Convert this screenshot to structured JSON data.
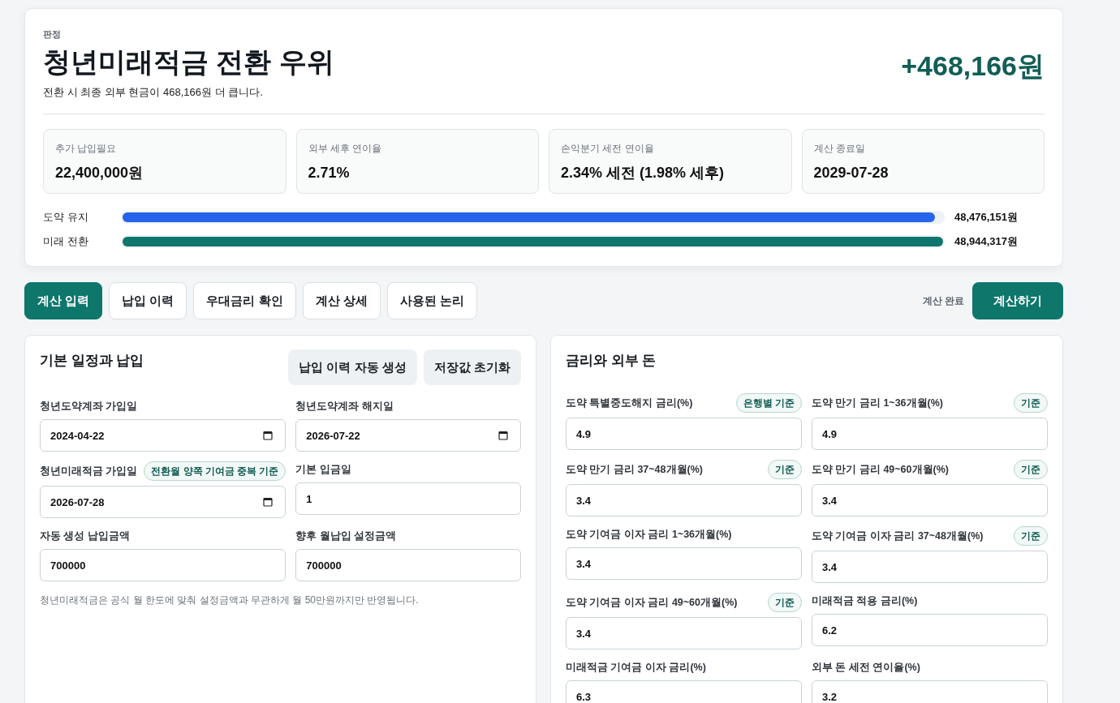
{
  "verdict": {
    "eyebrow": "판정",
    "title": "청년미래적금 전환 우위",
    "summary": "전환 시 최종 외부 현금이 468,166원 더 큽니다.",
    "difference": "+468,166원"
  },
  "stats": [
    {
      "label": "추가 납입필요",
      "value": "22,400,000원"
    },
    {
      "label": "외부 세후 연이율",
      "value": "2.71%"
    },
    {
      "label": "손익분기 세전 연이율",
      "value": "2.34% 세전 (1.98% 세후)"
    },
    {
      "label": "계산 종료일",
      "value": "2029-07-28"
    }
  ],
  "comparison": [
    {
      "label": "도약 유지",
      "level": 0.99,
      "color": "#2563eb",
      "amount": "48,476,151원"
    },
    {
      "label": "미래 전환",
      "level": 1,
      "color": "#0f766e",
      "amount": "48,944,317원"
    }
  ],
  "tabs": [
    {
      "label": "계산 입력",
      "selected": true
    },
    {
      "label": "납입 이력",
      "selected": false
    },
    {
      "label": "우대금리 확인",
      "selected": false
    },
    {
      "label": "계산 상세",
      "selected": false
    },
    {
      "label": "사용된 논리",
      "selected": false
    }
  ],
  "status": "계산 완료",
  "primary_button": "계산하기",
  "schedule_panel": {
    "title": "기본 일정과 납입",
    "buttons": [
      "납입 이력 자동 생성",
      "저장값 초기화"
    ],
    "fields": [
      {
        "label": "청년도약계좌 가입일",
        "kind": "date",
        "value": "2024-04-22"
      },
      {
        "label": "청년도약계좌 해지일",
        "kind": "date",
        "value": "2026-07-22"
      },
      {
        "label": "청년미래적금 가입일",
        "badge": "전환월 양쪽 기여금 중복 기준",
        "kind": "date",
        "value": "2026-07-28"
      },
      {
        "label": "기본 입금일",
        "kind": "number",
        "value": "1"
      },
      {
        "label": "자동 생성 납입금액",
        "kind": "number",
        "value": "700000"
      },
      {
        "label": "향후 월납입 설정금액",
        "kind": "number",
        "value": "700000"
      }
    ],
    "note": "청년미래적금은 공식 월 한도에 맞춰 설정금액과 무관하게 월 50만원까지만 반영됩니다."
  },
  "rates_panel": {
    "title": "금리와 외부 돈",
    "fields": [
      {
        "label": "도약 특별중도해지 금리(%)",
        "badge": "은행별 기준",
        "kind": "number",
        "value": "4.9"
      },
      {
        "label": "도약 만기 금리 1~36개월(%)",
        "badge": "기준",
        "kind": "number",
        "value": "4.9"
      },
      {
        "label": "도약 만기 금리 37~48개월(%)",
        "badge": "기준",
        "kind": "number",
        "value": "3.4"
      },
      {
        "label": "도약 만기 금리 49~60개월(%)",
        "badge": "기준",
        "kind": "number",
        "value": "3.4"
      },
      {
        "label": "도약 기여금 이자 금리 1~36개월(%)",
        "kind": "number",
        "value": "3.4"
      },
      {
        "label": "도약 기여금 이자 금리 37~48개월(%)",
        "badge": "기준",
        "kind": "number",
        "value": "3.4"
      },
      {
        "label": "도약 기여금 이자 금리 49~60개월(%)",
        "badge": "기준",
        "kind": "number",
        "value": "3.4"
      },
      {
        "label": "미래적금 적용 금리(%)",
        "kind": "number",
        "value": "6.2"
      },
      {
        "label": "미래적금 기여금 이자 금리(%)",
        "kind": "number",
        "value": "6.3"
      },
      {
        "label": "외부 돈 세전 연이율(%)",
        "kind": "number",
        "value": "3.2"
      }
    ]
  }
}
